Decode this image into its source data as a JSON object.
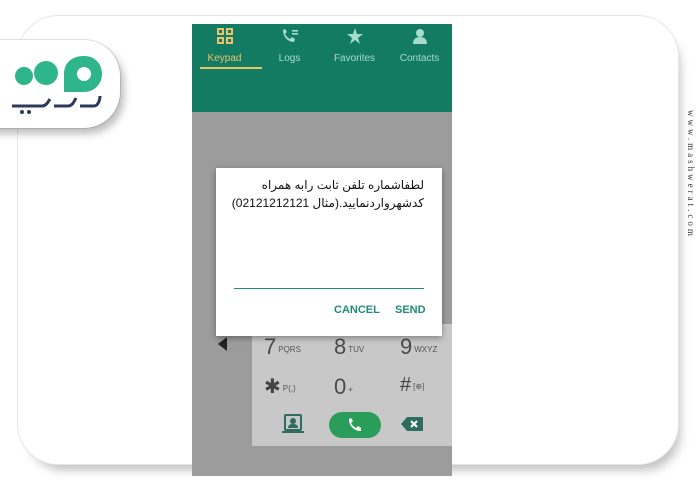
{
  "tabs": [
    {
      "label": "Keypad",
      "icon": "keypad-grid-icon",
      "active": true
    },
    {
      "label": "Logs",
      "icon": "call-log-icon",
      "active": false
    },
    {
      "label": "Favorites",
      "icon": "star-icon",
      "active": false
    },
    {
      "label": "Contacts",
      "icon": "person-icon",
      "active": false
    }
  ],
  "dialog": {
    "message_line1": "لطفاشماره تلفن ثابت رابه همراه",
    "message_line2": "کدشهرواردنمایید.(مثال 02121212121)",
    "input_value": "",
    "cancel_label": "CANCEL",
    "send_label": "SEND"
  },
  "keypad": {
    "row1": [
      {
        "digit": "7",
        "letters": "PQRS"
      },
      {
        "digit": "8",
        "letters": "TUV"
      },
      {
        "digit": "9",
        "letters": "WXYZ"
      }
    ],
    "row2": [
      {
        "symbol": "✱",
        "letters": "P(,)"
      },
      {
        "digit": "0",
        "letters": "+"
      },
      {
        "symbol": "#",
        "letters": "[⊕]"
      }
    ]
  },
  "watermark": {
    "vertical_url": "www.mashwerat.com",
    "logo_text": "مشورت"
  },
  "colors": {
    "tab_bar": "#147b63",
    "accent_teal": "#1e8c7a",
    "call_green": "#2a9d5a",
    "logo_green": "#2fb58a",
    "tab_active": "#e8c36a"
  }
}
